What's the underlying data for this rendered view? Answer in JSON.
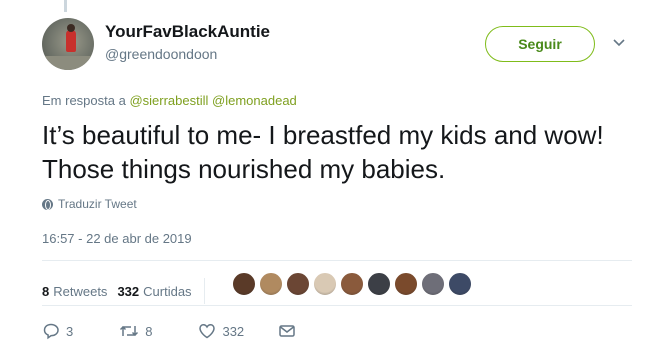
{
  "user": {
    "display_name": "YourFavBlackAuntie",
    "handle": "@greendoondoon"
  },
  "follow_label": "Seguir",
  "reply": {
    "prefix": "Em resposta a",
    "mentions": [
      "@sierrabestill",
      "@lemonadead"
    ]
  },
  "tweet": {
    "text": "It’s beautiful to me- I breastfed my kids and wow! Those things nourished my babies.",
    "translate_label": "Traduzir Tweet",
    "timestamp": "16:57 - 22 de abr de 2019"
  },
  "stats": {
    "retweets_count": "8",
    "retweets_label": "Retweets",
    "likes_count": "332",
    "likes_label": "Curtidas",
    "liker_colors": [
      "#5a3a28",
      "#b08a60",
      "#6b4634",
      "#d9c9b4",
      "#8a5a3c",
      "#3c3f46",
      "#7a4a2c",
      "#6e6e78",
      "#3d4a66"
    ]
  },
  "actions": {
    "reply_count": "3",
    "retweet_count": "8",
    "like_count": "332"
  },
  "colors": {
    "accent": "#7fbc1a",
    "muted": "#657786"
  }
}
